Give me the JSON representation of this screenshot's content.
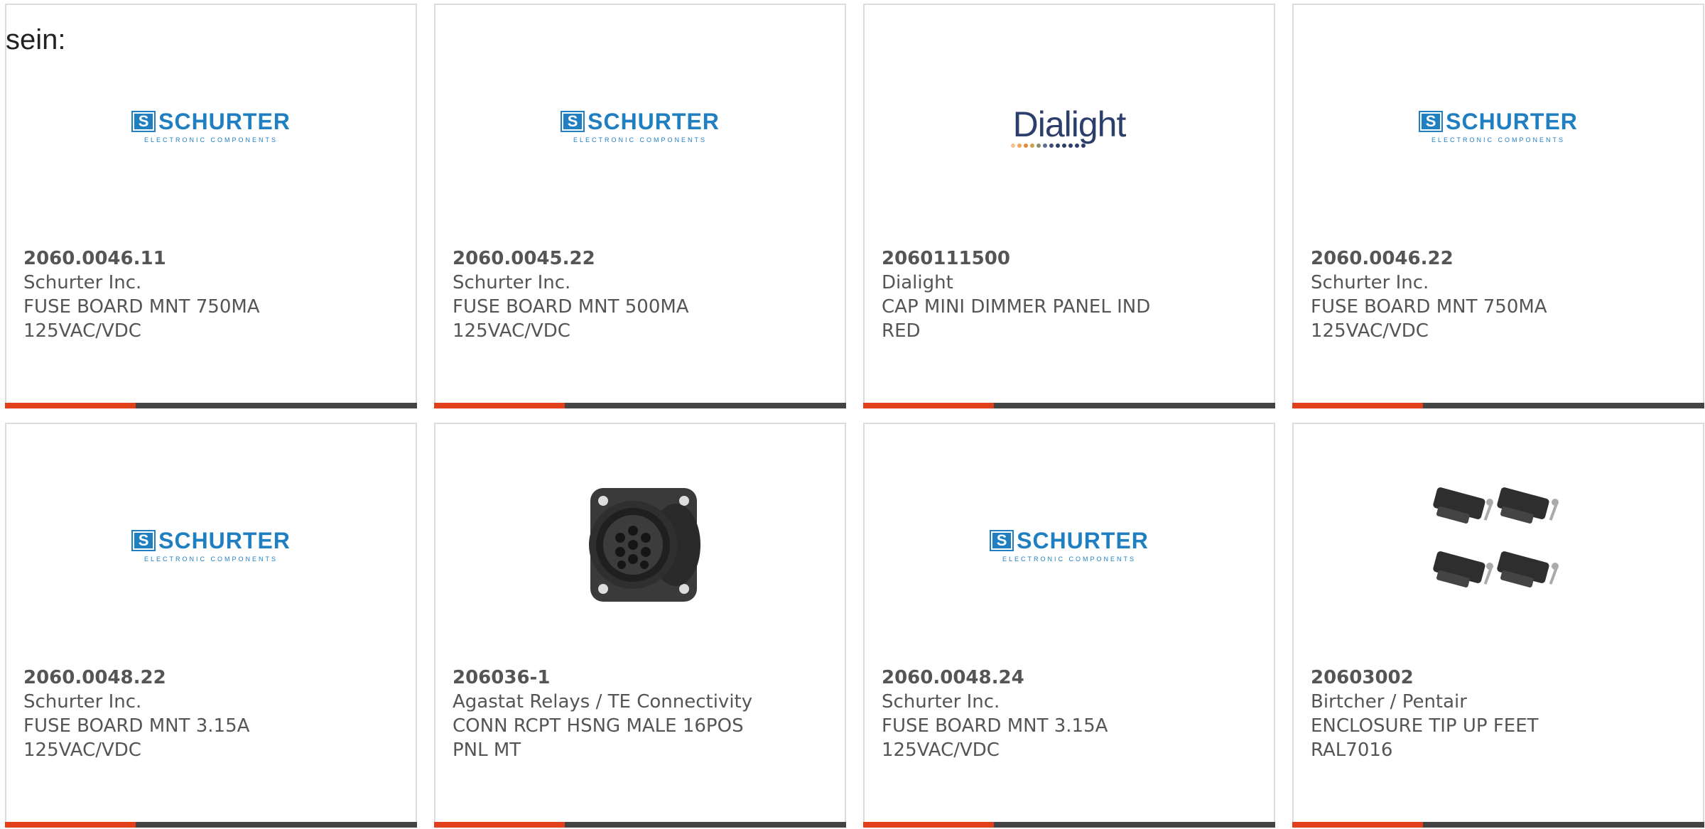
{
  "intro_text": "sein:",
  "colors": {
    "accent": "#e2401b",
    "bar": "#444444",
    "schurter_blue": "#1f7fc1",
    "dialight_navy": "#2c3e6b"
  },
  "products": [
    {
      "part_number": "2060.0046.11",
      "manufacturer": "Schurter Inc.",
      "description_line1": "FUSE BOARD MNT 750MA",
      "description_line2": "125VAC/VDC",
      "image": "schurter-logo",
      "logo_word": "SCHURTER",
      "logo_sub": "ELECTRONIC COMPONENTS"
    },
    {
      "part_number": "2060.0045.22",
      "manufacturer": "Schurter Inc.",
      "description_line1": "FUSE BOARD MNT 500MA",
      "description_line2": "125VAC/VDC",
      "image": "schurter-logo",
      "logo_word": "SCHURTER",
      "logo_sub": "ELECTRONIC COMPONENTS"
    },
    {
      "part_number": "2060111500",
      "manufacturer": "Dialight",
      "description_line1": "CAP MINI DIMMER PANEL IND",
      "description_line2": "RED",
      "image": "dialight-logo",
      "logo_word": "Dialight"
    },
    {
      "part_number": "2060.0046.22",
      "manufacturer": "Schurter Inc.",
      "description_line1": "FUSE BOARD MNT 750MA",
      "description_line2": "125VAC/VDC",
      "image": "schurter-logo",
      "logo_word": "SCHURTER",
      "logo_sub": "ELECTRONIC COMPONENTS"
    },
    {
      "part_number": "2060.0048.22",
      "manufacturer": "Schurter Inc.",
      "description_line1": "FUSE BOARD MNT 3.15A",
      "description_line2": "125VAC/VDC",
      "image": "schurter-logo",
      "logo_word": "SCHURTER",
      "logo_sub": "ELECTRONIC COMPONENTS"
    },
    {
      "part_number": "206036-1",
      "manufacturer": "Agastat Relays / TE Connectivity",
      "description_line1": "CONN RCPT HSNG MALE 16POS",
      "description_line2": "PNL MT",
      "image": "connector-photo"
    },
    {
      "part_number": "2060.0048.24",
      "manufacturer": "Schurter Inc.",
      "description_line1": "FUSE BOARD MNT 3.15A",
      "description_line2": "125VAC/VDC",
      "image": "schurter-logo",
      "logo_word": "SCHURTER",
      "logo_sub": "ELECTRONIC COMPONENTS"
    },
    {
      "part_number": "20603002",
      "manufacturer": "Birtcher / Pentair",
      "description_line1": "ENCLOSURE TIP UP FEET",
      "description_line2": "RAL7016",
      "image": "enclosure-feet-photo"
    }
  ]
}
